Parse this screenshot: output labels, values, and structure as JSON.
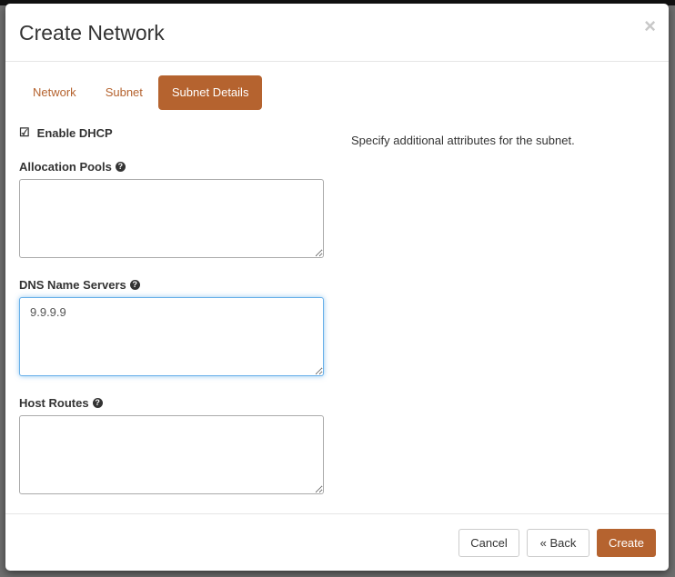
{
  "modal": {
    "title": "Create Network",
    "close_icon": "×",
    "tabs": [
      {
        "label": "Network",
        "active": false
      },
      {
        "label": "Subnet",
        "active": false
      },
      {
        "label": "Subnet Details",
        "active": true
      }
    ],
    "enable_dhcp": {
      "label": "Enable DHCP",
      "checked": true,
      "icon": "☑"
    },
    "help_icon": "?",
    "allocation_pools": {
      "label": "Allocation Pools",
      "value": ""
    },
    "dns_name_servers": {
      "label": "DNS Name Servers",
      "value": "9.9.9.9"
    },
    "host_routes": {
      "label": "Host Routes",
      "value": ""
    },
    "help_text": "Specify additional attributes for the subnet.",
    "buttons": {
      "cancel": "Cancel",
      "back": "« Back",
      "create": "Create"
    }
  },
  "colors": {
    "accent": "#b5632f",
    "focus": "#66afe9"
  }
}
